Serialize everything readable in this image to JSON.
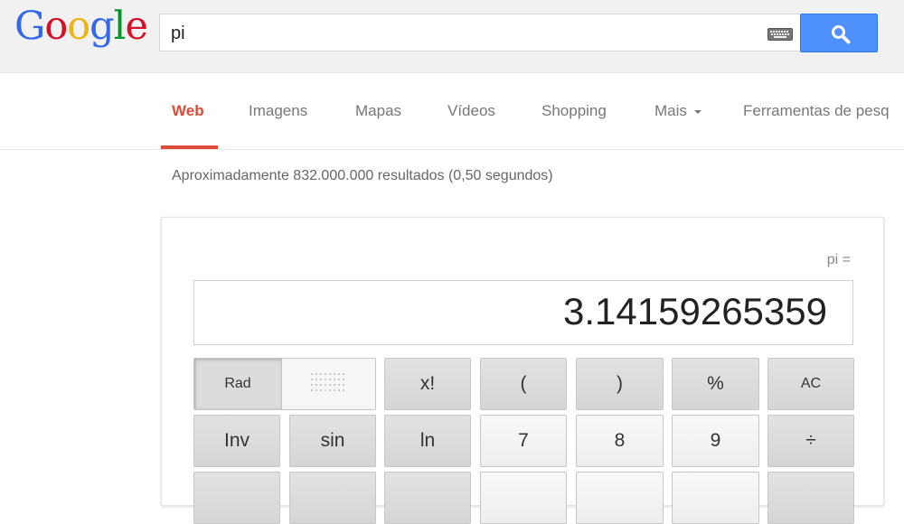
{
  "logo": {
    "letters": [
      "G",
      "o",
      "o",
      "g",
      "l",
      "e"
    ],
    "colors": [
      "#3369e8",
      "#d50f25",
      "#eeb211",
      "#3369e8",
      "#009925",
      "#d50f25"
    ]
  },
  "search": {
    "query": "pi"
  },
  "tabs": [
    {
      "label": "Web"
    },
    {
      "label": "Imagens"
    },
    {
      "label": "Mapas"
    },
    {
      "label": "Vídeos"
    },
    {
      "label": "Shopping"
    },
    {
      "label": "Mais"
    },
    {
      "label": "Ferramentas de pesq"
    }
  ],
  "stats": "Aproximadamente 832.000.000 resultados (0,50 segundos)",
  "calculator": {
    "expression": "pi =",
    "result": "3.14159265359",
    "mode_selected": "Rad",
    "row1": [
      "x!",
      "(",
      ")",
      "%",
      "AC"
    ],
    "row2": [
      "Inv",
      "sin",
      "ln",
      "7",
      "8",
      "9",
      "÷"
    ]
  },
  "colors": {
    "accent_red": "#dd4b39",
    "search_blue": "#4d90fe"
  }
}
